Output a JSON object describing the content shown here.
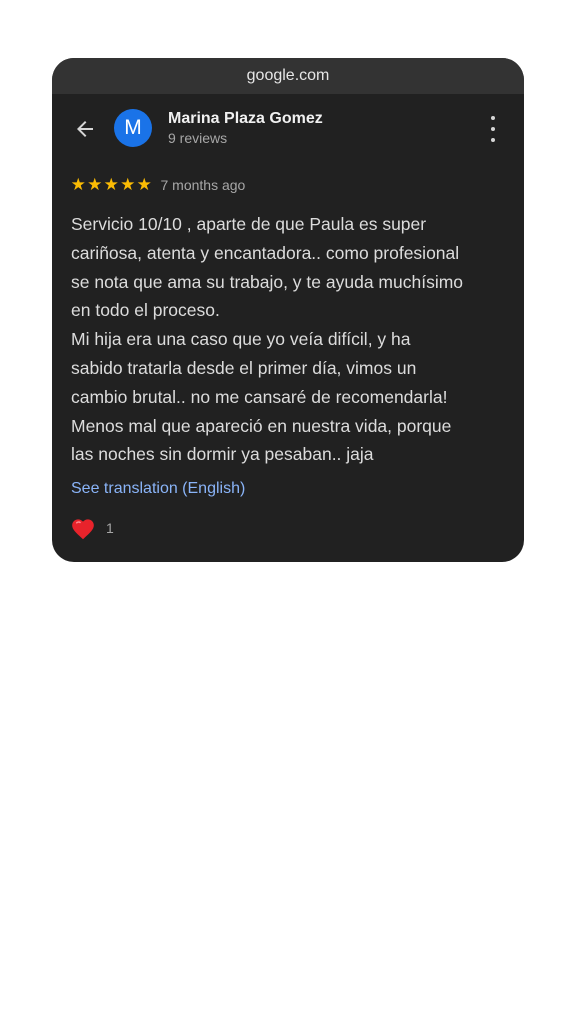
{
  "browser": {
    "url": "google.com"
  },
  "reviewer": {
    "avatar_letter": "M",
    "name": "Marina Plaza Gomez",
    "reviews_count": "9 reviews"
  },
  "review": {
    "rating": 5,
    "max_rating": 5,
    "time_ago": "7 months ago",
    "text_lines": [
      "Servicio 10/10 , aparte de que Paula es super",
      "cariñosa, atenta y encantadora.. como profesional",
      "se nota que ama su trabajo, y te ayuda muchísimo",
      "en todo el proceso.",
      "Mi hija era una caso que yo veía difícil, y ha",
      "sabido tratarla desde el primer día, vimos un",
      "cambio brutal.. no me cansaré de recomendarla!",
      "Menos mal que apareció en nuestra vida, porque",
      "las noches sin dormir ya pesaban.. jaja"
    ],
    "translation_link": "See translation (English)",
    "reaction_count": "1"
  },
  "icons": {
    "back": "arrow-back-icon",
    "more": "more-vert-icon",
    "star": "star-icon",
    "reaction": "heart-icon"
  },
  "colors": {
    "card_bg": "#212121",
    "url_bar_bg": "#333333",
    "avatar_bg": "#1a73e8",
    "star": "#fbbc04",
    "link": "#8ab4f8",
    "heart": "#e8232b"
  }
}
